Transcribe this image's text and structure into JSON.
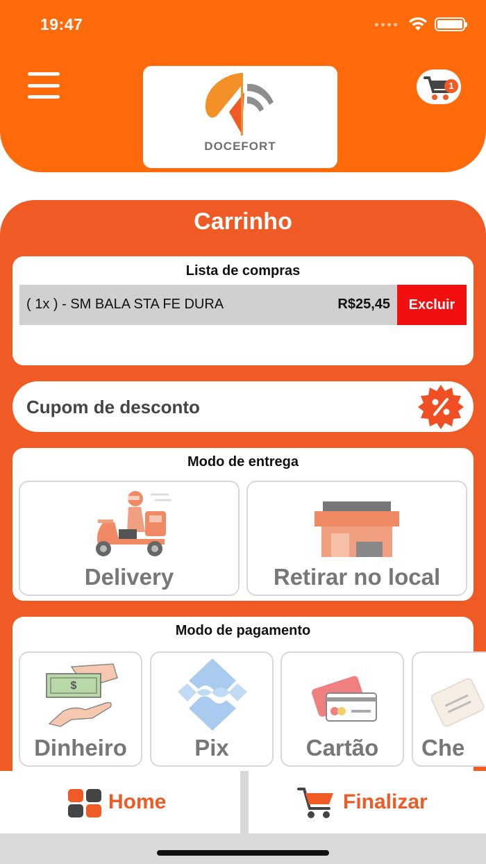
{
  "status_bar": {
    "time": "19:47"
  },
  "header": {
    "logo_text": "DOCEFORT",
    "cart_count": "1"
  },
  "cart": {
    "title": "Carrinho",
    "list_title": "Lista de compras",
    "items": [
      {
        "name": "( 1x ) - SM BALA STA FE DURA",
        "price": "R$25,45",
        "delete_label": "Excluir"
      }
    ]
  },
  "coupon": {
    "label": "Cupom de desconto"
  },
  "delivery": {
    "title": "Modo de entrega",
    "options": [
      {
        "label": "Delivery"
      },
      {
        "label": "Retirar no local"
      }
    ]
  },
  "payment": {
    "title": "Modo de pagamento",
    "options": [
      {
        "label": "Dinheiro"
      },
      {
        "label": "Pix"
      },
      {
        "label": "Cartão"
      },
      {
        "label": "Che"
      }
    ]
  },
  "bottom_nav": {
    "home_label": "Home",
    "finish_label": "Finalizar"
  },
  "colors": {
    "header_orange": "#ff6b0a",
    "main_orange": "#f05a24",
    "delete_red": "#f20f0f"
  }
}
